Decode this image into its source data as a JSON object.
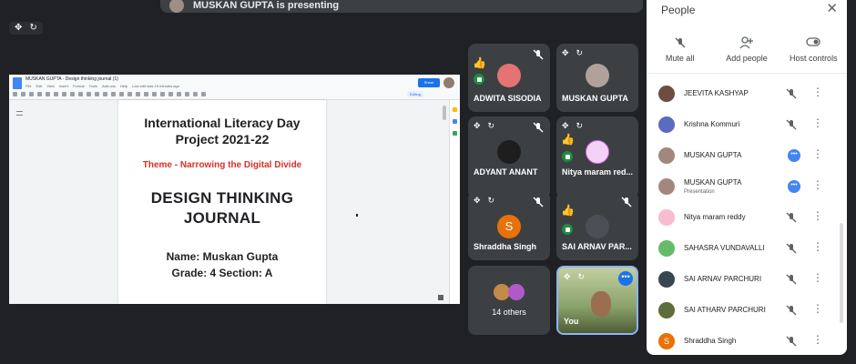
{
  "banner": {
    "text": "MUSKAN GUPTA is presenting"
  },
  "presentation": {
    "doc_title": "MUSKAN GUPTA - Design thinking journal (1)",
    "menu": [
      "File",
      "Edit",
      "View",
      "Insert",
      "Format",
      "Tools",
      "Add-ons",
      "Help",
      "Last edit was 15 minutes ago"
    ],
    "share_label": "Share",
    "editing_label": "Editing",
    "page": {
      "title_line1": "International Literacy Day",
      "title_line2": "Project 2021-22",
      "theme": "Theme - Narrowing the Digital Divide",
      "heading_line1": "DESIGN THINKING",
      "heading_line2": "JOURNAL",
      "name_line": "Name: Muskan Gupta",
      "grade_line": "Grade: 4 Section: A"
    }
  },
  "tiles": [
    {
      "name": "ADWITA SISODIA",
      "color": "#e57373"
    },
    {
      "name": "MUSKAN GUPTA",
      "color": "#b0a29a"
    },
    {
      "name": "ADYANT ANANT",
      "color": "#3a3a3a"
    },
    {
      "name": "Nitya maram red...",
      "color": "#f3d2f5"
    },
    {
      "name": "Shraddha Singh",
      "initial": "S",
      "color": "#e8710a"
    },
    {
      "name": "SAI ARNAV PAR...",
      "color": "#4a4f55"
    },
    {
      "name": "14 others"
    },
    {
      "name": "You"
    }
  ],
  "people_panel": {
    "title": "People",
    "actions": [
      {
        "label": "Mute all",
        "icon": "mic-off-icon"
      },
      {
        "label": "Add people",
        "icon": "add-person-icon"
      },
      {
        "label": "Host controls",
        "icon": "toggle-icon"
      }
    ],
    "participants": [
      {
        "name": "JEEVITA KASHYAP",
        "color": "#6d4c41",
        "status": "muted"
      },
      {
        "name": "Krishna Kommuri",
        "color": "#5c6bc0",
        "status": "muted"
      },
      {
        "name": "MUSKAN GUPTA",
        "color": "#a1887f",
        "status": "more"
      },
      {
        "name": "MUSKAN GUPTA",
        "sub": "Presentation",
        "color": "#a1887f",
        "status": "more"
      },
      {
        "name": "Nitya maram reddy",
        "color": "#f48fb1",
        "status": "muted"
      },
      {
        "name": "SAHASRA VUNDAVALLI",
        "color": "#66bb6a",
        "status": "muted"
      },
      {
        "name": "SAI ARNAV PARCHURI",
        "color": "#37474f",
        "status": "muted"
      },
      {
        "name": "SAI ATHARV PARCHURI",
        "color": "#5d6d3b",
        "status": "muted"
      },
      {
        "name": "Shraddha Singh",
        "initial": "S",
        "color": "#e8710a",
        "status": "muted"
      }
    ]
  }
}
